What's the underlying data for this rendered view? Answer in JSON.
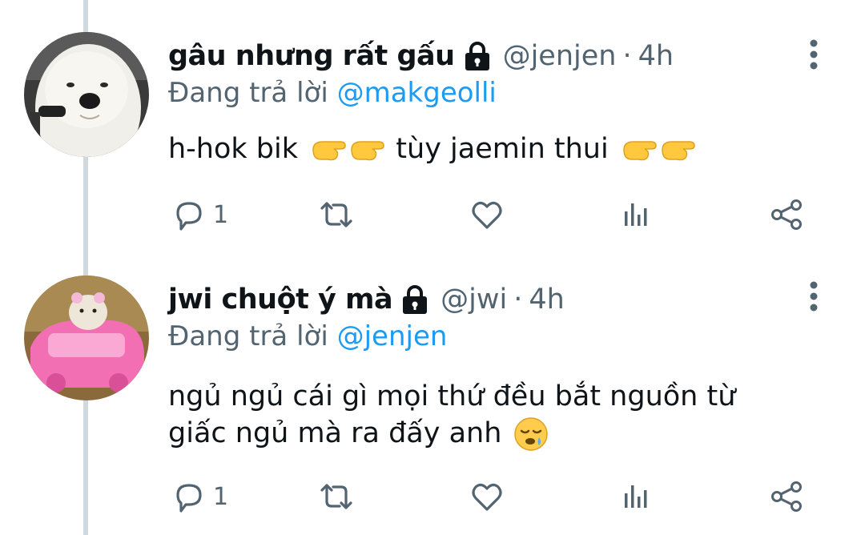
{
  "tweets": [
    {
      "display_name": "gâu nhưng rất gấu",
      "handle": "@jenjen",
      "separator": "·",
      "time": "4h",
      "replying_to_prefix": "Đang trả lời",
      "replying_to_handle": "@makgeolli",
      "body_parts": [
        "h-hok bik",
        "tùy jaemin thui"
      ],
      "reply_count": "1",
      "avatar_icon": "white-dog-avatar",
      "emoji_icon": "pointing-hands-emoji"
    },
    {
      "display_name": "jwi chuột ý mà",
      "handle": "@jwi",
      "separator": "·",
      "time": "4h",
      "replying_to_prefix": "Đang trả lời",
      "replying_to_handle": "@jenjen",
      "body_line1": "ngủ ngủ cái gì mọi thứ đều bắt nguồn từ",
      "body_line2": "giấc ngủ mà ra đấy anh",
      "reply_count": "1",
      "avatar_icon": "hamster-in-pink-car-avatar",
      "emoji_icon": "sleepy-face-emoji"
    }
  ],
  "colors": {
    "text": "#0f1419",
    "muted": "#536471",
    "link": "#1d9bf0",
    "thread_line": "#cfd9de"
  }
}
